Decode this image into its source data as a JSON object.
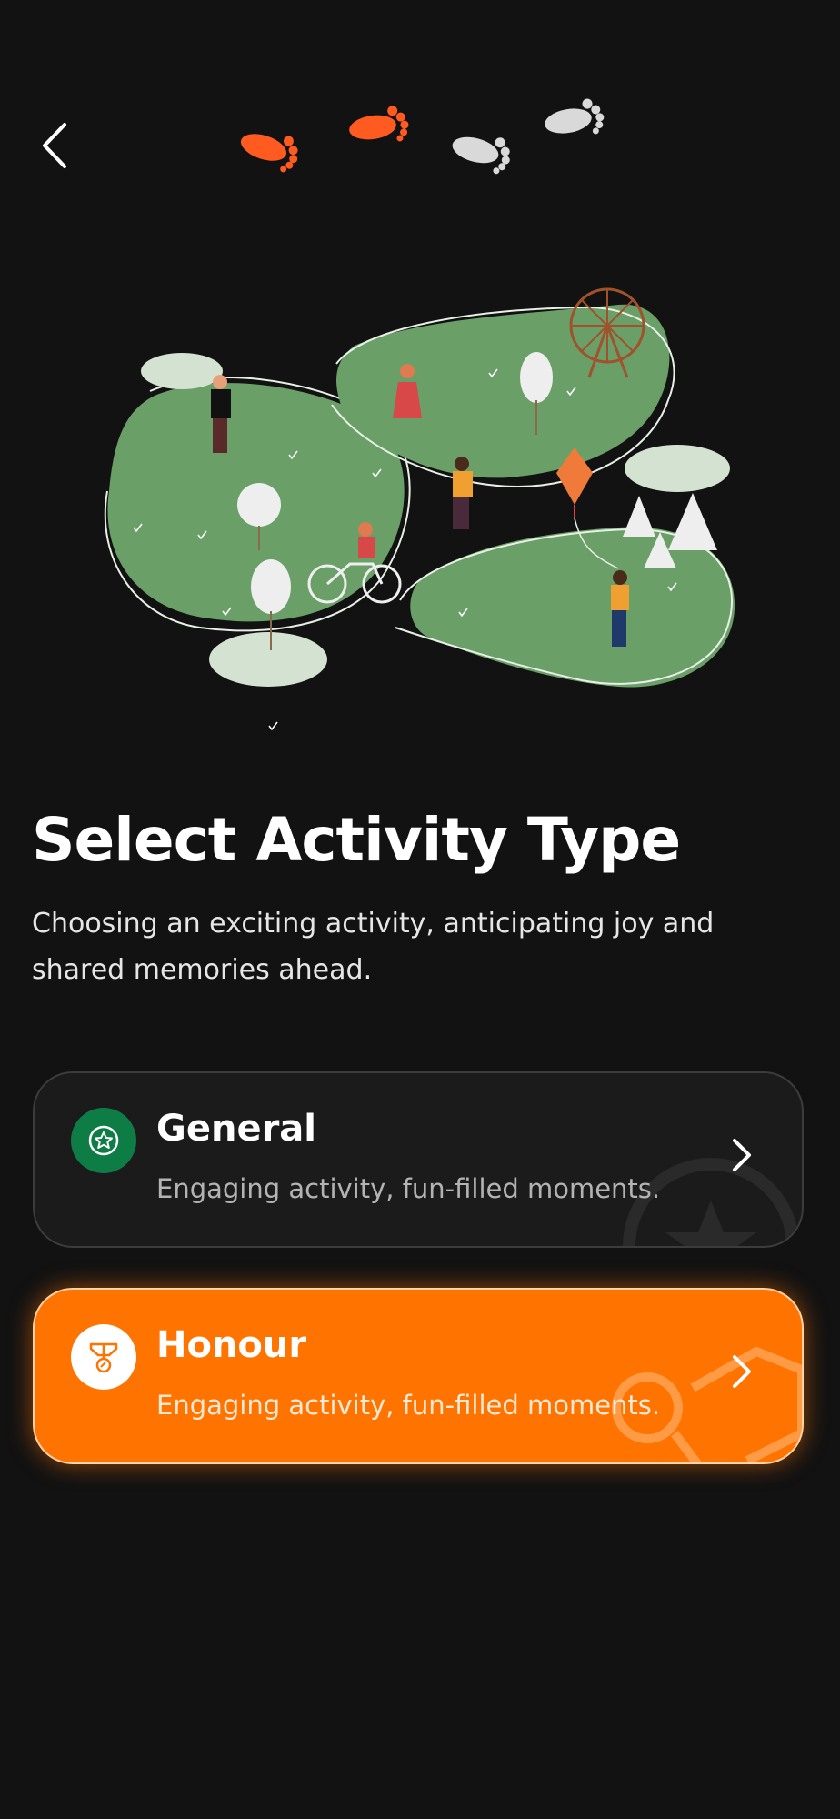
{
  "header": {
    "back_icon": "chevron-left-icon",
    "steps": [
      {
        "icon": "footprint-icon",
        "state": "done",
        "color": "#ff5a1f"
      },
      {
        "icon": "footprint-icon",
        "state": "done",
        "color": "#ff5a1f"
      },
      {
        "icon": "footprint-icon",
        "state": "todo",
        "color": "#d9d9d9"
      },
      {
        "icon": "footprint-icon",
        "state": "todo",
        "color": "#d9d9d9"
      }
    ]
  },
  "hero": {
    "illustration": "park-activities-illustration"
  },
  "title": "Select Activity Type",
  "subtitle": "Choosing an exciting activity, anticipating joy and shared memories ahead.",
  "options": [
    {
      "title": "General",
      "description": "Engaging activity, fun-filled moments.",
      "icon": "star-badge-icon",
      "selected": false,
      "accent": "#0e7d45"
    },
    {
      "title": "Honour",
      "description": "Engaging activity, fun-filled moments.",
      "icon": "medal-icon",
      "selected": true,
      "accent": "#ff7300"
    }
  ]
}
